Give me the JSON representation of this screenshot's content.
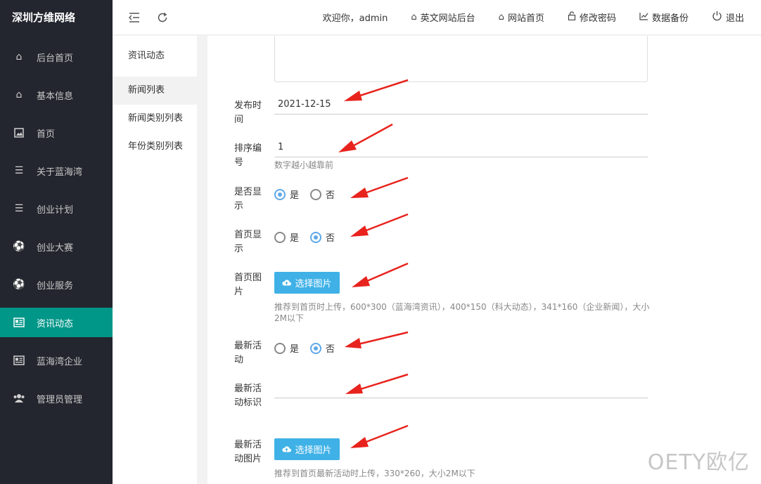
{
  "brand": "深圳方维网络",
  "sidebar": {
    "items": [
      {
        "label": "后台首页",
        "icon": "home-icon"
      },
      {
        "label": "基本信息",
        "icon": "home-icon"
      },
      {
        "label": "首页",
        "icon": "image-icon"
      },
      {
        "label": "关于蓝海湾",
        "icon": "list-icon"
      },
      {
        "label": "创业计划",
        "icon": "list-icon"
      },
      {
        "label": "创业大赛",
        "icon": "football-icon"
      },
      {
        "label": "创业服务",
        "icon": "football-icon"
      },
      {
        "label": "资讯动态",
        "icon": "newspaper-icon",
        "active": true
      },
      {
        "label": "蓝海湾企业",
        "icon": "newspaper-icon"
      },
      {
        "label": "管理员管理",
        "icon": "users-icon"
      }
    ]
  },
  "header": {
    "welcome": "欢迎你，admin",
    "links": [
      {
        "label": "英文网站后台",
        "icon": "home-icon"
      },
      {
        "label": "网站首页",
        "icon": "home-icon"
      },
      {
        "label": "修改密码",
        "icon": "lock-icon"
      },
      {
        "label": "数据备份",
        "icon": "chart-icon"
      },
      {
        "label": "退出",
        "icon": "power-icon"
      }
    ]
  },
  "subnav": {
    "title": "资讯动态",
    "items": [
      "新闻列表",
      "新闻类别列表",
      "年份类别列表"
    ]
  },
  "form": {
    "publish_label": "发布时间",
    "publish_value": "2021-12-15",
    "sort_label": "排序编号",
    "sort_value": "1",
    "sort_hint": "数字越小越靠前",
    "show_label": "是否显示",
    "home_show_label": "首页显示",
    "home_image_label": "首页图片",
    "home_image_hint": "推荐到首页时上传，600*300（蓝海湾资讯），400*150（科大动态），341*160（企业新闻），大小2M以下",
    "latest_label": "最新活动",
    "latest_tag_label": "最新活动标识",
    "latest_tag_value": "",
    "latest_image_label": "最新活动图片",
    "latest_image_hint": "推荐到首页最新活动时上传，330*260，大小2M以下",
    "yes": "是",
    "no": "否",
    "upload_label": "选择图片"
  },
  "watermark": "OETY欧亿",
  "colors": {
    "accent": "#009688",
    "sidebar_bg": "#23262e",
    "upload_btn": "#3fb1e7",
    "arrow": "#e8231d"
  }
}
